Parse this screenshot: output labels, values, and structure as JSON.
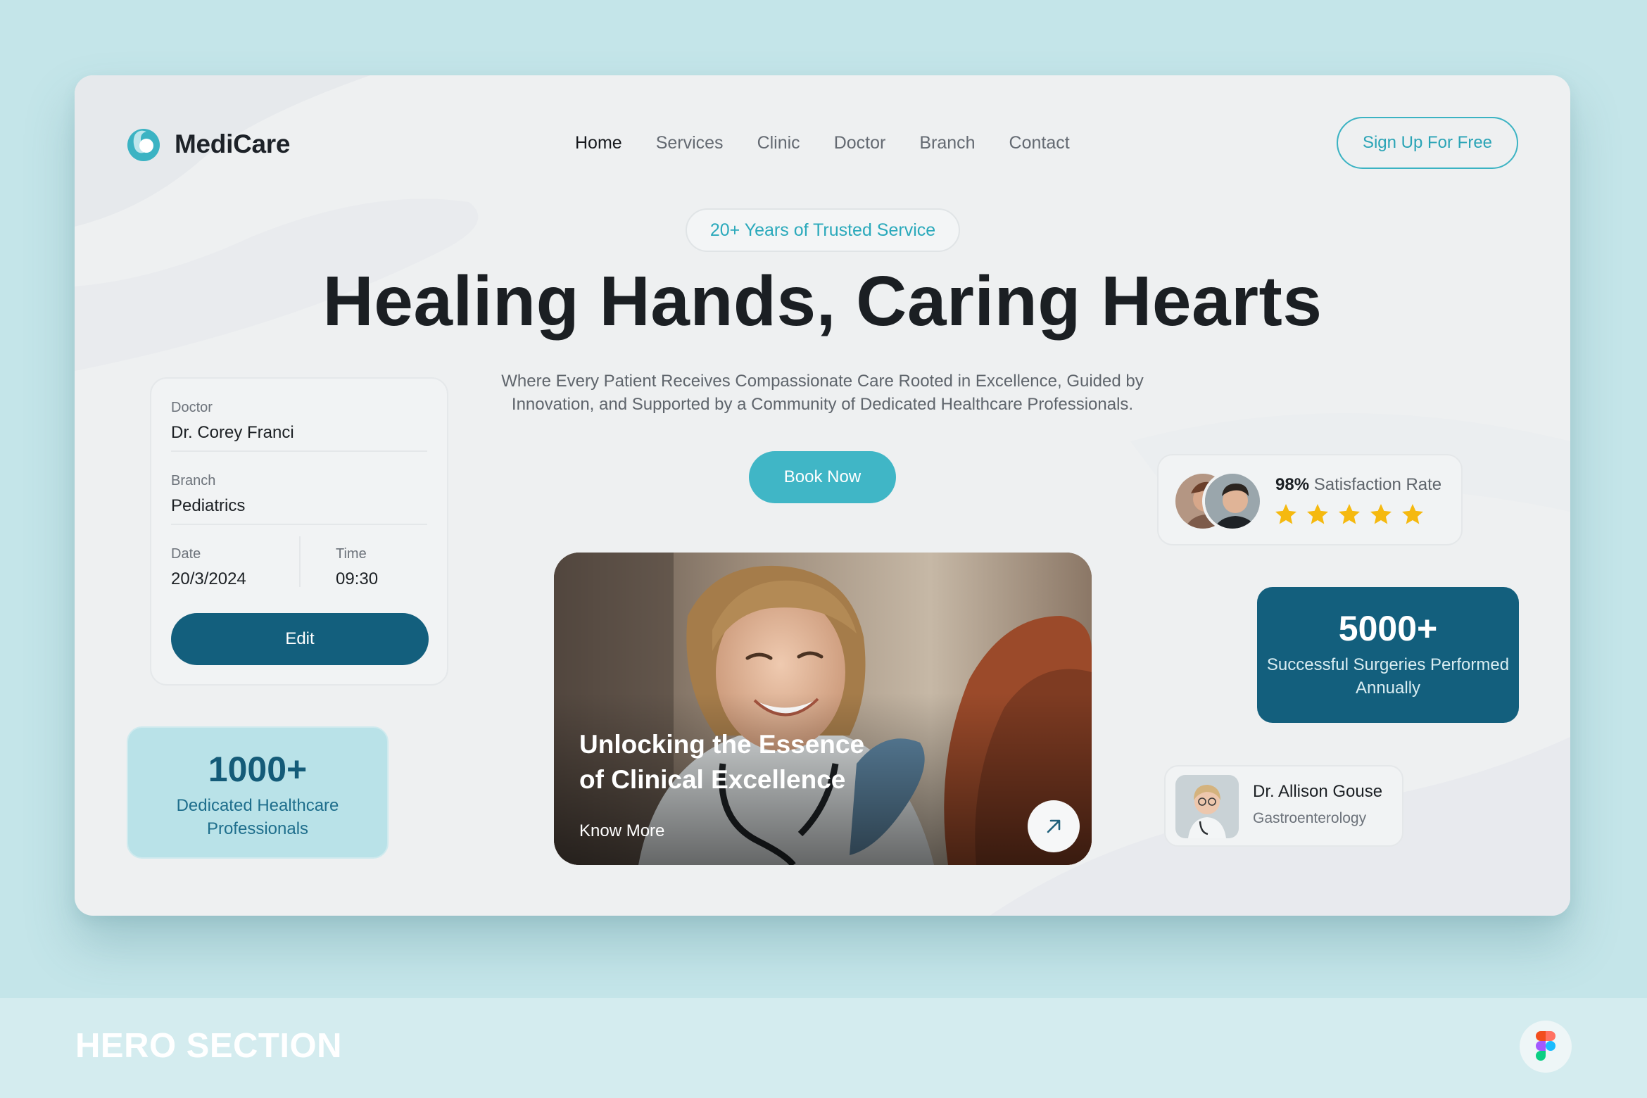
{
  "brand": {
    "name": "MediCare",
    "accent": "#40b6c6",
    "dark": "#135f7d"
  },
  "nav": {
    "items": [
      {
        "label": "Home",
        "active": true
      },
      {
        "label": "Services",
        "active": false
      },
      {
        "label": "Clinic",
        "active": false
      },
      {
        "label": "Doctor",
        "active": false
      },
      {
        "label": "Branch",
        "active": false
      },
      {
        "label": "Contact",
        "active": false
      }
    ],
    "signup_label": "Sign Up For Free"
  },
  "hero": {
    "badge": "20+ Years of Trusted Service",
    "title": "Healing Hands, Caring Hearts",
    "subtitle": "Where Every Patient Receives Compassionate Care Rooted in Excellence, Guided by Innovation, and Supported by a Community of Dedicated Healthcare Professionals.",
    "cta_label": "Book Now"
  },
  "appointment": {
    "doctor_label": "Doctor",
    "doctor_value": "Dr. Corey Franci",
    "branch_label": "Branch",
    "branch_value": "Pediatrics",
    "date_label": "Date",
    "date_value": "20/3/2024",
    "time_label": "Time",
    "time_value": "09:30",
    "edit_label": "Edit"
  },
  "stats": {
    "professionals": {
      "number": "1000+",
      "label": "Dedicated Healthcare Professionals"
    },
    "surgeries": {
      "number": "5000+",
      "label": "Successful Surgeries Performed Annually"
    }
  },
  "satisfaction": {
    "rate": "98%",
    "label": "Satisfaction Rate",
    "stars": 5,
    "star_color": "#f5b90f"
  },
  "feature": {
    "title": "Unlocking the Essence of Clinical Excellence",
    "link_label": "Know More",
    "arrow_icon": "arrow-up-right-icon"
  },
  "doctor_card": {
    "name": "Dr. Allison Gouse",
    "specialty": "Gastroenterology"
  },
  "footer": {
    "section_label": "HERO SECTION",
    "tool_icon": "figma-icon"
  }
}
